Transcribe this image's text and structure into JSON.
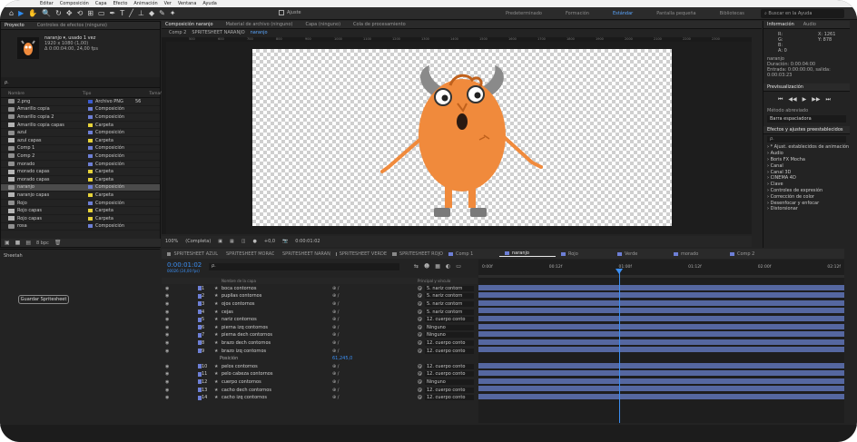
{
  "menubar": {
    "items": [
      "Editar",
      "Composición",
      "Capa",
      "Efecto",
      "Animación",
      "Ver",
      "Ventana",
      "Ayuda"
    ]
  },
  "workspaces": {
    "items": [
      "Predeterminado",
      "Formación",
      "Estándar",
      "Pantalla pequeña",
      "Bibliotecas"
    ],
    "active": 2
  },
  "help_search": "Buscar en la Ayuda",
  "project": {
    "tabs": [
      "Proyecto",
      "Controles de efectos (ninguno)"
    ],
    "selected_name": "naranjo ▾, usado 1 vez",
    "selected_info": [
      "1920 x 1080 (1,00)",
      "Δ 0:00:04:00, 24,00 fps"
    ],
    "search_placeholder": "ρ.",
    "columns": [
      "Nombre",
      "Tipo",
      "Tamaño"
    ],
    "items": [
      {
        "name": "2.png",
        "type": "Archivo PNG",
        "size": "56",
        "color": "#3a5bd0",
        "kind": "file"
      },
      {
        "name": "Amarillo copia",
        "type": "Composición",
        "color": "#6d7fd6",
        "kind": "comp"
      },
      {
        "name": "Amarillo copia 2",
        "type": "Composición",
        "color": "#6d7fd6",
        "kind": "comp"
      },
      {
        "name": "Amarillo copia capas",
        "type": "Carpeta",
        "color": "#e6d23a",
        "kind": "folder"
      },
      {
        "name": "azul",
        "type": "Composición",
        "color": "#6d7fd6",
        "kind": "comp"
      },
      {
        "name": "azul capas",
        "type": "Carpeta",
        "color": "#e6d23a",
        "kind": "folder"
      },
      {
        "name": "Comp 1",
        "type": "Composición",
        "color": "#6d7fd6",
        "kind": "comp"
      },
      {
        "name": "Comp 2",
        "type": "Composición",
        "color": "#6d7fd6",
        "kind": "comp"
      },
      {
        "name": "morado",
        "type": "Composición",
        "color": "#6d7fd6",
        "kind": "comp"
      },
      {
        "name": "morado capas",
        "type": "Carpeta",
        "color": "#e6d23a",
        "kind": "folder"
      },
      {
        "name": "morado capas",
        "type": "Carpeta",
        "color": "#e6d23a",
        "kind": "folder"
      },
      {
        "name": "naranjo",
        "type": "Composición",
        "color": "#6d7fd6",
        "kind": "comp",
        "selected": true
      },
      {
        "name": "naranjo capas",
        "type": "Carpeta",
        "color": "#e6d23a",
        "kind": "folder"
      },
      {
        "name": "Rojo",
        "type": "Composición",
        "color": "#6d7fd6",
        "kind": "comp"
      },
      {
        "name": "Rojo capas",
        "type": "Carpeta",
        "color": "#e6d23a",
        "kind": "folder"
      },
      {
        "name": "Rojo capas",
        "type": "Carpeta",
        "color": "#e6d23a",
        "kind": "folder"
      },
      {
        "name": "rosa",
        "type": "Composición",
        "color": "#6d7fd6",
        "kind": "comp"
      }
    ],
    "footer_bpc": "8 bpc"
  },
  "comp_panel": {
    "tabs": [
      "Composición naranjo",
      "Material de archivo (ninguno)",
      "Capa (ninguno)",
      "Cola de procesamiento"
    ],
    "breadcrumbs": [
      "Comp 2",
      "SPRITESHEET NARANJO",
      "naranjo"
    ],
    "ruler": [
      "500",
      "600",
      "700",
      "800",
      "900",
      "1000",
      "1100",
      "1200",
      "1300",
      "1400",
      "1500",
      "1600",
      "1700",
      "1800",
      "1900",
      "2000",
      "2100",
      "2200",
      "2300"
    ]
  },
  "viewer_bar": {
    "zoom": "100%",
    "quality": "(Completa)",
    "exposure": "+0,0",
    "timecode": "0:00:01:02"
  },
  "info_panel": {
    "tabs": [
      "Información",
      "Audio"
    ],
    "values": [
      "R:",
      "G:",
      "B:",
      "A: 0"
    ],
    "coords": [
      "X: 1261",
      "Y: 878"
    ],
    "details": [
      "naranjo",
      "Duración: 0:00:04:00",
      "Entrada: 0:00:00:00, salida: 0:00:03:23"
    ]
  },
  "preview_panel": {
    "title": "Previsualización",
    "shortcut_label": "Método abreviado",
    "shortcut_value": "Barra espaciadora"
  },
  "effects_panel": {
    "title": "Efectos y ajustes preestablecidos",
    "search": "ρ.",
    "items": [
      "* Ajust. establecidos de animación",
      "Audio",
      "Boris FX Mocha",
      "Canal",
      "Canal 3D",
      "CINEMA 4D",
      "Clave",
      "Controles de expresión",
      "Corrección de color",
      "Desenfocar y enfocar",
      "Distorsionar"
    ]
  },
  "spritesheet_panel": {
    "title": "Sheetah",
    "button": "Guardar Spritesheet"
  },
  "timeline": {
    "tabs": [
      "SPRITESHEET AZUL",
      "SPRITESHEET MORADO",
      "SPRITESHEET NARANJO",
      "SPRITESHEET VERDE",
      "SPRITESHEET ROJO",
      "Comp 1",
      "naranjo",
      "Rojo",
      "Verde",
      "morado",
      "Comp 2"
    ],
    "active_tab": 6,
    "time": "0:00:01:02",
    "frames_info": "00026 (24,00 fps)",
    "col_headers": [
      "Nombre de la capa",
      "Principal y vínculo"
    ],
    "ruler": [
      "0:00f",
      "00:12f",
      "01:00f",
      "01:12f",
      "02:00f",
      "02:12f"
    ],
    "layers": [
      {
        "n": "1",
        "name": "boca contornos",
        "parent": "5. nariz contorn"
      },
      {
        "n": "2",
        "name": "pupilas contornos",
        "parent": "5. nariz contorn"
      },
      {
        "n": "3",
        "name": "ojos contornos",
        "parent": "5. nariz contorn"
      },
      {
        "n": "4",
        "name": "cejas",
        "parent": "5. nariz contorn"
      },
      {
        "n": "5",
        "name": "nariz contornos",
        "parent": "12. cuerpo conto"
      },
      {
        "n": "6",
        "name": "pierna izq contornos",
        "parent": "Ninguno"
      },
      {
        "n": "7",
        "name": "pierna dech contornos",
        "parent": "Ninguno"
      },
      {
        "n": "8",
        "name": "brazo dech contornos",
        "parent": "12. cuerpo conto"
      },
      {
        "n": "9",
        "name": "brazo izq contornos",
        "parent": "12. cuerpo conto"
      },
      {
        "n": "",
        "name": "Posición",
        "parent": "",
        "value": "61,245,0",
        "property": true
      },
      {
        "n": "10",
        "name": "pelos contornos",
        "parent": "12. cuerpo conto"
      },
      {
        "n": "11",
        "name": "pelo cabeza contornos",
        "parent": "12. cuerpo conto"
      },
      {
        "n": "12",
        "name": "cuerpo contornos",
        "parent": "Ninguno"
      },
      {
        "n": "13",
        "name": "cacho dech contornos",
        "parent": "12. cuerpo conto"
      },
      {
        "n": "14",
        "name": "cacho izq contornos",
        "parent": "12. cuerpo conto"
      }
    ]
  },
  "colors": {
    "accent": "#2e8cf0",
    "layer_bar": "#5567a0",
    "comp_label": "#6d7fd6",
    "folder_label": "#e6d23a",
    "monster_body": "#f08a3c"
  }
}
